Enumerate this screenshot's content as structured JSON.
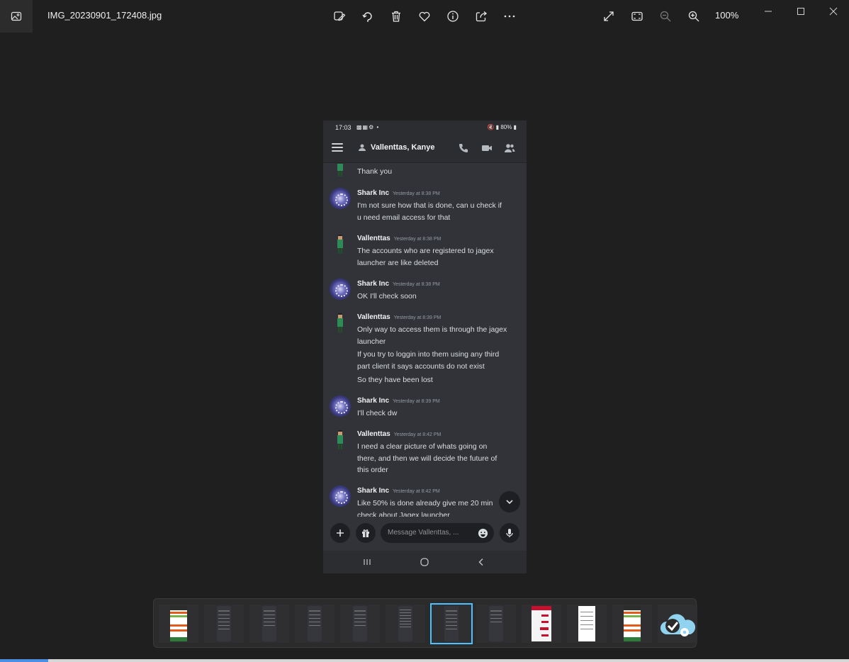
{
  "window": {
    "file_name": "IMG_20230901_172408.jpg",
    "zoom": "100%"
  },
  "toolbar": {
    "icons": [
      "edit-image-icon",
      "rotate-icon",
      "delete-icon",
      "favorite-icon",
      "info-icon",
      "share-icon",
      "more-icon"
    ],
    "right_icons": [
      "full-screen-icon",
      "fit-to-window-icon",
      "zoom-out-icon",
      "zoom-in-icon"
    ]
  },
  "phone": {
    "status": {
      "time": "17:03",
      "battery": "80%"
    },
    "header": {
      "title": "Vallenttas, Kanye"
    },
    "messages": [
      {
        "text": "Thank you"
      },
      {
        "author": "Shark Inc",
        "time": "Yesterday at 8:38 PM",
        "lines": [
          "I'm not sure how that is done, can u check if",
          "u need email access for that"
        ]
      },
      {
        "author": "Vallenttas",
        "time": "Yesterday at 8:38 PM",
        "lines": [
          "The accounts who are registered to jagex",
          "launcher are like deleted"
        ]
      },
      {
        "author": "Shark Inc",
        "time": "Yesterday at 8:38 PM",
        "lines": [
          "OK I'll check soon"
        ]
      },
      {
        "author": "Vallenttas",
        "time": "Yesterday at 8:39 PM",
        "lines": [
          "Only way to access them is through the jagex",
          "launcher"
        ],
        "extra": [
          [
            "If you try to loggin into them using any third",
            "part client it says accounts do not exist"
          ],
          [
            "So they have been lost"
          ]
        ]
      },
      {
        "author": "Shark Inc",
        "time": "Yesterday at 8:39 PM",
        "lines": [
          "I'll check dw"
        ]
      },
      {
        "author": "Vallenttas",
        "time": "Yesterday at 8:42 PM",
        "lines": [
          "I need a clear picture of whats going on",
          "there, and then we will decide the future of",
          "this order"
        ]
      },
      {
        "author": "Shark Inc",
        "time": "Yesterday at 8:42 PM",
        "lines": [
          "Like 50% is done already give me 20 min",
          "check about Jagex launcher"
        ]
      }
    ],
    "composer": {
      "placeholder": "Message Vallenttas, ..."
    }
  },
  "filmstrip": {
    "count": 12,
    "selected_index": 6
  }
}
